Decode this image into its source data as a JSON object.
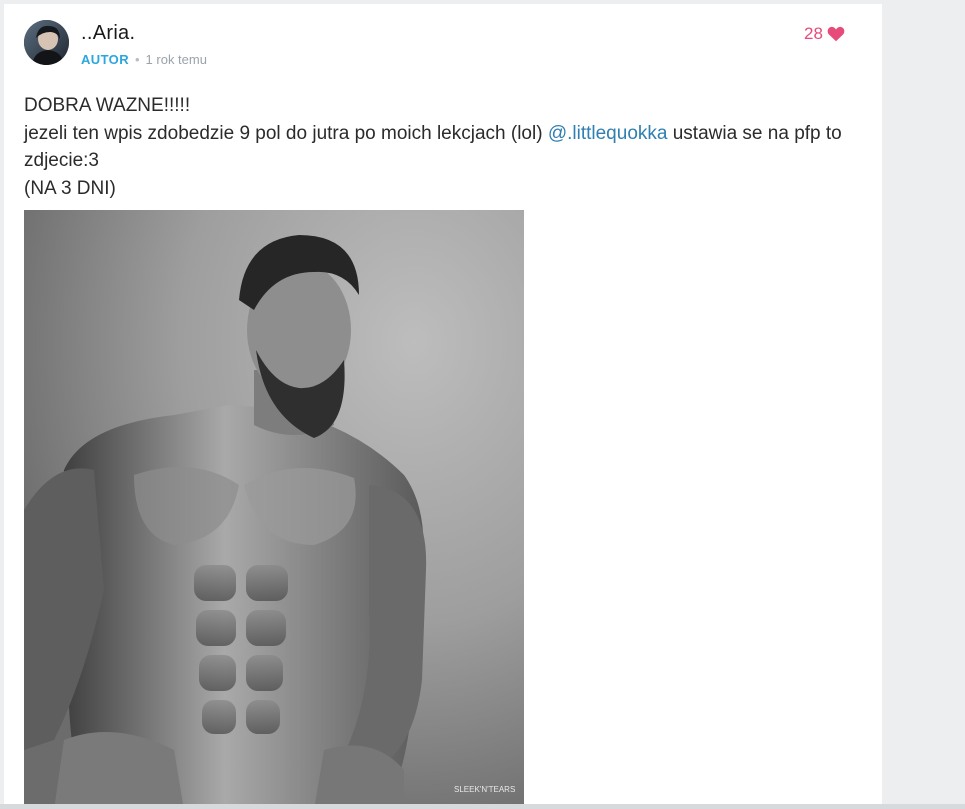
{
  "post": {
    "author": {
      "name": "..Aria.",
      "badge": "AUTOR",
      "separator": "•",
      "timestamp": "1 rok temu",
      "avatar_icon": "profile-avatar"
    },
    "likes": {
      "count": "28",
      "icon": "heart-icon",
      "color": "#e64b7a"
    },
    "content": {
      "line1": "DOBRA WAZNE!!!!!",
      "line2_before": "jezeli ten wpis zdobedzie 9 pol do jutra po moich lekcjach (lol) ",
      "mention": "@.littlequokka",
      "line2_after": " ustawia se na pfp to zdjecie:3",
      "line3": "(NA 3 DNI)"
    },
    "image": {
      "watermark": "SLEEK'N'TEARS"
    }
  },
  "colors": {
    "accent": "#2ba7de",
    "mention": "#2f7fb1",
    "background": "#eceef0"
  }
}
